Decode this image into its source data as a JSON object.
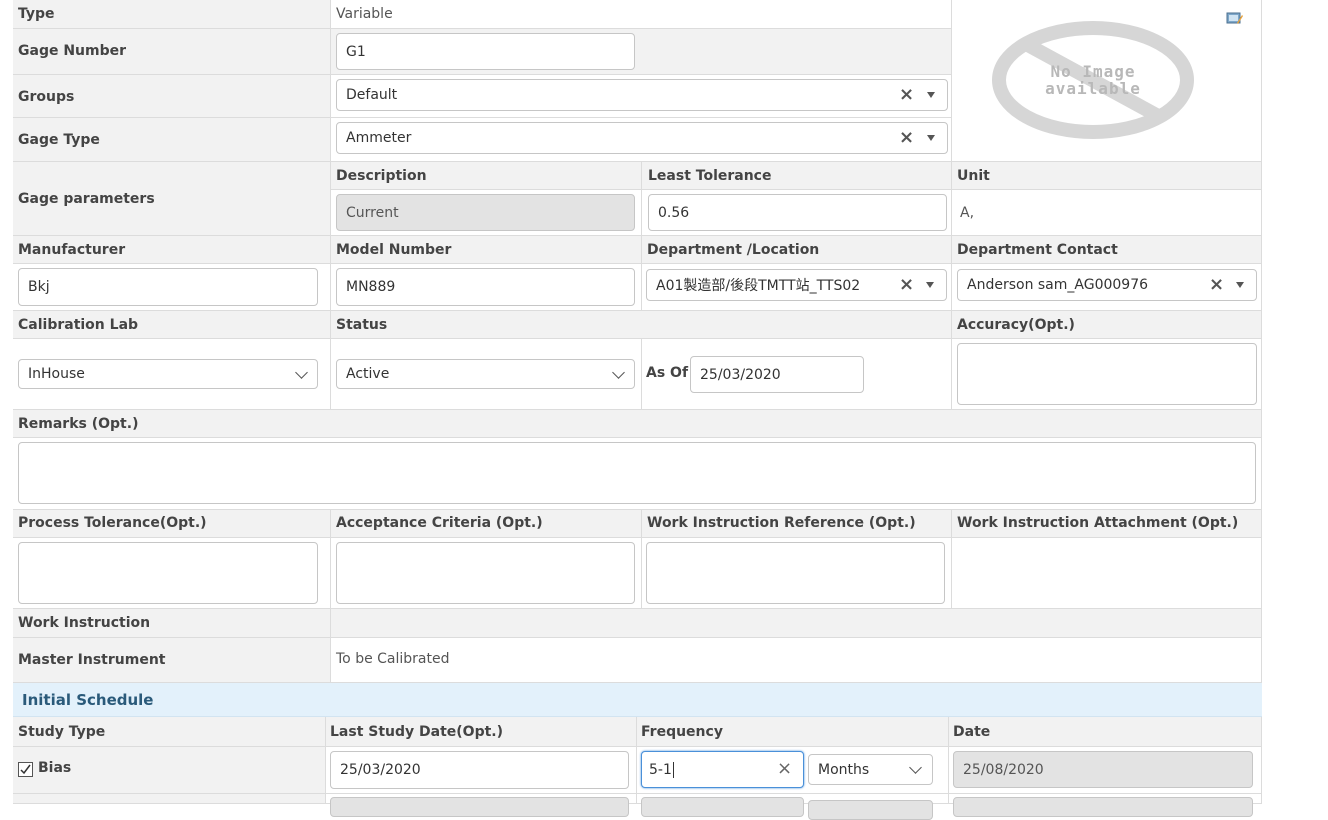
{
  "form": {
    "type": {
      "label": "Type",
      "value": "Variable"
    },
    "gage_number": {
      "label": "Gage Number",
      "value": "G1"
    },
    "groups": {
      "label": "Groups",
      "value": "Default"
    },
    "gage_type": {
      "label": "Gage Type",
      "value": "Ammeter"
    },
    "no_image": {
      "line1": "No Image",
      "line2": "available"
    },
    "gage_parameters": {
      "label": "Gage parameters",
      "description_header": "Description",
      "least_tolerance_header": "Least Tolerance",
      "unit_header": "Unit",
      "description_value": "Current",
      "least_tolerance_value": "0.56",
      "unit_value": "A,"
    },
    "manufacturer": {
      "label": "Manufacturer",
      "value": "Bkj"
    },
    "model_number": {
      "label": "Model Number",
      "value": "MN889"
    },
    "department_location": {
      "label": "Department /Location",
      "value": "A01製造部/後段TMTT站_TTS02"
    },
    "department_contact": {
      "label": "Department Contact",
      "value": "Anderson sam_AG000976"
    },
    "calibration_lab": {
      "label": "Calibration Lab",
      "value": "InHouse"
    },
    "status": {
      "label": "Status",
      "value": "Active",
      "as_of_label": "As Of",
      "as_of_value": "25/03/2020"
    },
    "accuracy": {
      "label": "Accuracy(Opt.)",
      "value": ""
    },
    "remarks": {
      "label": "Remarks (Opt.)",
      "value": ""
    },
    "process_tolerance": {
      "label": "Process Tolerance(Opt.)",
      "value": ""
    },
    "acceptance_criteria": {
      "label": "Acceptance Criteria (Opt.)",
      "value": ""
    },
    "wi_reference": {
      "label": "Work Instruction Reference (Opt.)",
      "value": ""
    },
    "wi_attachment": {
      "label": "Work Instruction Attachment (Opt.)"
    },
    "work_instruction": {
      "label": "Work Instruction"
    },
    "master_instrument": {
      "label": "Master Instrument",
      "value": "To be Calibrated"
    }
  },
  "schedule": {
    "title": "Initial Schedule",
    "headers": {
      "study_type": "Study Type",
      "last_study_date": "Last Study Date(Opt.)",
      "frequency": "Frequency",
      "date": "Date"
    },
    "rows": [
      {
        "study_type": "Bias",
        "checked": true,
        "last_study_date": "25/03/2020",
        "frequency": "5-1",
        "frequency_unit": "Months",
        "date": "25/08/2020"
      }
    ]
  },
  "colors": {
    "label_bg": "#f2f2f2",
    "border": "#dcdcdc",
    "section_bg": "#e3f1fb",
    "section_text": "#2a5a7a",
    "focus": "#4a90d9"
  }
}
